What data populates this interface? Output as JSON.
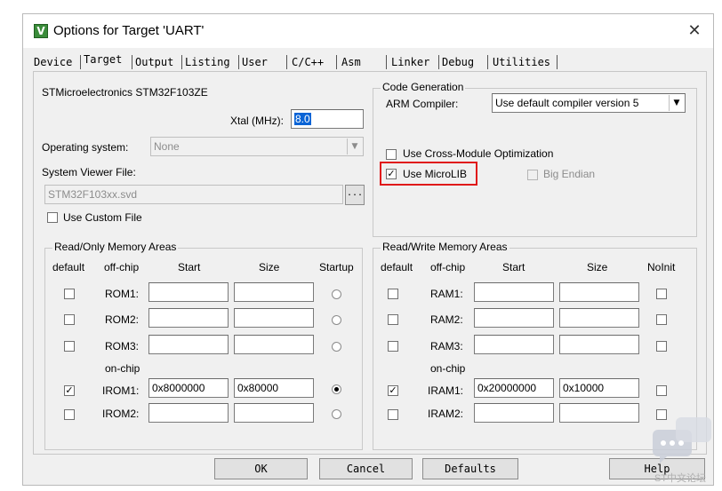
{
  "window": {
    "title": "Options for Target 'UART'",
    "close_glyph": "✕",
    "icon_letter": "V"
  },
  "tabs": [
    "Device",
    "Target",
    "Output",
    "Listing",
    "User",
    "C/C++",
    "Asm",
    "Linker",
    "Debug",
    "Utilities"
  ],
  "active_tab": "Target",
  "target": {
    "device_name": "STMicroelectronics STM32F103ZE",
    "xtal_label": "Xtal (MHz):",
    "xtal_value": "8.0",
    "os_label": "Operating system:",
    "os_value": "None",
    "viewer_label": "System Viewer File:",
    "viewer_value": "STM32F103xx.svd",
    "viewer_browse": "...",
    "custom_file_label": "Use Custom File",
    "custom_file_checked": false
  },
  "codegen": {
    "title": "Code Generation",
    "compiler_label": "ARM Compiler:",
    "compiler_value": "Use default compiler version 5",
    "cross_module_label": "Use Cross-Module Optimization",
    "cross_module_checked": false,
    "microlib_label": "Use MicroLIB",
    "microlib_checked": true,
    "big_endian_label": "Big Endian",
    "big_endian_checked": false,
    "highlight_color": "#e0191a"
  },
  "ro_memory": {
    "title": "Read/Only Memory Areas",
    "headers": {
      "default": "default",
      "offchip": "off-chip",
      "start": "Start",
      "size": "Size",
      "startup": "Startup"
    },
    "onchip_label": "on-chip",
    "rows": [
      {
        "name": "ROM1:",
        "start": "",
        "size": "",
        "default": false,
        "startup": false
      },
      {
        "name": "ROM2:",
        "start": "",
        "size": "",
        "default": false,
        "startup": false
      },
      {
        "name": "ROM3:",
        "start": "",
        "size": "",
        "default": false,
        "startup": false
      },
      {
        "name": "IROM1:",
        "start": "0x8000000",
        "size": "0x80000",
        "default": true,
        "startup": true
      },
      {
        "name": "IROM2:",
        "start": "",
        "size": "",
        "default": false,
        "startup": false
      }
    ]
  },
  "rw_memory": {
    "title": "Read/Write Memory Areas",
    "headers": {
      "default": "default",
      "offchip": "off-chip",
      "start": "Start",
      "size": "Size",
      "noinit": "NoInit"
    },
    "onchip_label": "on-chip",
    "rows": [
      {
        "name": "RAM1:",
        "start": "",
        "size": "",
        "default": false,
        "noinit": false
      },
      {
        "name": "RAM2:",
        "start": "",
        "size": "",
        "default": false,
        "noinit": false
      },
      {
        "name": "RAM3:",
        "start": "",
        "size": "",
        "default": false,
        "noinit": false
      },
      {
        "name": "IRAM1:",
        "start": "0x20000000",
        "size": "0x10000",
        "default": true,
        "noinit": false
      },
      {
        "name": "IRAM2:",
        "start": "",
        "size": "",
        "default": false,
        "noinit": false
      }
    ]
  },
  "buttons": {
    "ok": "OK",
    "cancel": "Cancel",
    "defaults": "Defaults",
    "help": "Help"
  },
  "watermark": {
    "text": "ST中文论坛"
  }
}
